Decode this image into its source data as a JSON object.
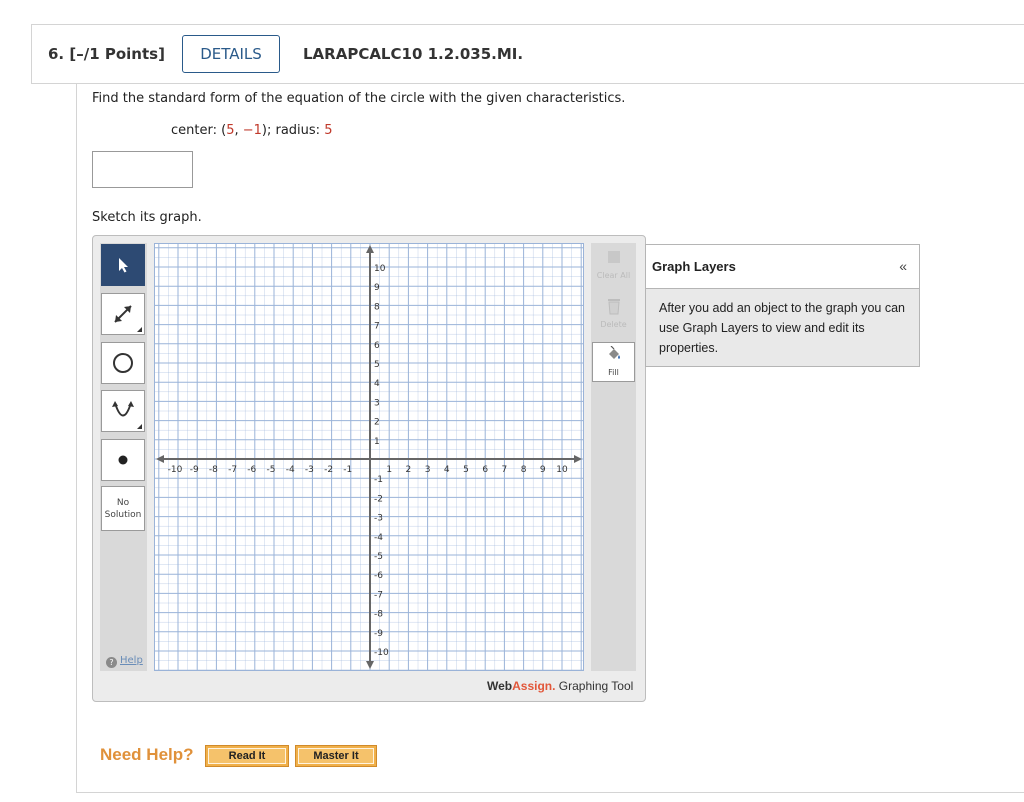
{
  "question": {
    "number_points": "6.  [–/1 Points]",
    "details_label": "DETAILS",
    "code": "LARAPCALC10 1.2.035.MI.",
    "prompt": "Find the standard form of the equation of the circle with the given characteristics.",
    "given_center_label": "center: (",
    "center_x": "5",
    "center_sep": ", ",
    "center_y": "−1",
    "given_radius_label": "); radius: ",
    "radius": "5",
    "answer_value": "",
    "sketch_label": "Sketch its graph."
  },
  "toolbar_left": {
    "no_solution": [
      "No",
      "Solution"
    ],
    "help_label": "Help"
  },
  "toolbar_right": {
    "clear_all": "Clear All",
    "delete": "Delete",
    "fill": "Fill"
  },
  "graph": {
    "x_ticks": [
      "-10",
      "-9",
      "-8",
      "-7",
      "-6",
      "-5",
      "-4",
      "-3",
      "-2",
      "-1",
      "1",
      "2",
      "3",
      "4",
      "5",
      "6",
      "7",
      "8",
      "9",
      "10"
    ],
    "y_ticks": [
      "10",
      "9",
      "8",
      "7",
      "6",
      "5",
      "4",
      "3",
      "2",
      "1",
      "-1",
      "-2",
      "-3",
      "-4",
      "-5",
      "-6",
      "-7",
      "-8",
      "-9",
      "-10"
    ],
    "xlim": [
      -11,
      11
    ],
    "ylim": [
      -11,
      11
    ],
    "grid_color": "#9ab3d8",
    "axis_color": "#666666"
  },
  "brand": {
    "web": "Web",
    "assign": "Assign.",
    "tool": " Graphing Tool"
  },
  "layers": {
    "title": "Graph Layers",
    "collapse": "«",
    "body": "After you add an object to the graph you can use Graph Layers to view and edit its properties."
  },
  "help": {
    "need_help": "Need Help?",
    "read_it": "Read It",
    "master_it": "Master It"
  }
}
